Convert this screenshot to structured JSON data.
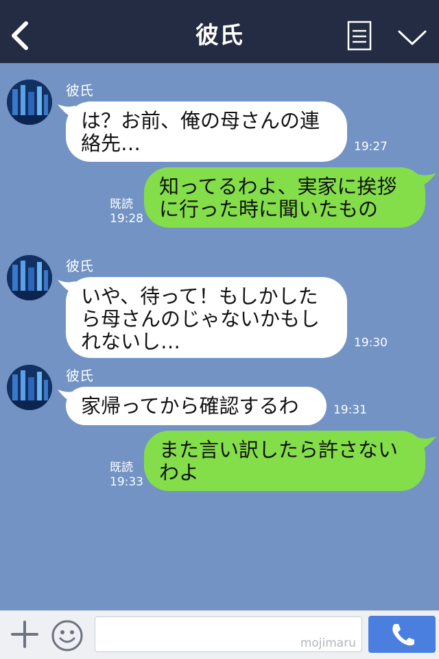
{
  "header": {
    "title": "彼氏",
    "icons": {
      "back": "chevron-left-icon",
      "menu": "menu-icon",
      "toggle": "chevron-down-icon"
    }
  },
  "colors": {
    "header_bg": "#232c42",
    "chat_bg": "#7293c4",
    "incoming_bubble": "#ffffff",
    "outgoing_bubble": "#84de4a",
    "call_button": "#4a7fe0"
  },
  "messages": [
    {
      "direction": "in",
      "sender": "彼氏",
      "text": "は？お前、俺の母さんの連\n絡先…",
      "time": "19:27"
    },
    {
      "direction": "out",
      "text": "知ってるわよ、実家に挨拶\nに行った時に聞いたもの",
      "read_label": "既読",
      "time": "19:28"
    },
    {
      "direction": "in",
      "sender": "彼氏",
      "text": "いや、待って！もしかした\nら母さんのじゃないかもし\nれないし…",
      "time": "19:30"
    },
    {
      "direction": "in",
      "sender": "彼氏",
      "text": "家帰ってから確認するわ",
      "time": "19:31"
    },
    {
      "direction": "out",
      "text": "また言い訳したら許さない\nわよ",
      "read_label": "既読",
      "time": "19:33"
    }
  ],
  "footer": {
    "watermark": "mojimaru",
    "icons": {
      "add": "plus-icon",
      "emoji": "smiley-icon",
      "call": "phone-icon"
    }
  }
}
